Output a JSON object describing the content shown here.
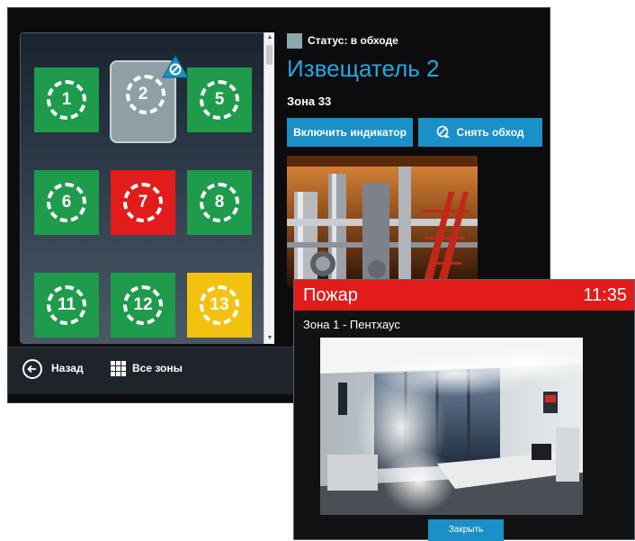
{
  "zones_panel": {
    "tiles": [
      {
        "number": "1",
        "state": "normal",
        "color": "#1e9b4b"
      },
      {
        "number": "2",
        "state": "bypassed",
        "color": "#8ea0a6"
      },
      {
        "number": "5",
        "state": "normal",
        "color": "#1e9b4b"
      },
      {
        "number": "6",
        "state": "normal",
        "color": "#1e9b4b"
      },
      {
        "number": "7",
        "state": "alarm",
        "color": "#e21b1b"
      },
      {
        "number": "8",
        "state": "normal",
        "color": "#1e9b4b"
      },
      {
        "number": "11",
        "state": "normal",
        "color": "#1e9b4b"
      },
      {
        "number": "12",
        "state": "normal",
        "color": "#1e9b4b"
      },
      {
        "number": "13",
        "state": "fault",
        "color": "#f3c211"
      }
    ],
    "bypass_icon": "no-entry-icon"
  },
  "detail": {
    "status_label": "Статус: в обходе",
    "status_color": "#8aa7ad",
    "title": "Извещатель 2",
    "zone": "Зона 33",
    "enable_indicator_button": "Включить индикатор",
    "remove_bypass_button": "Снять обход",
    "remove_bypass_icon": "bypass-off-icon"
  },
  "bottom_bar": {
    "back_label": "Назад",
    "back_icon": "arrow-left-circle-icon",
    "all_zones_label": "Все зоны",
    "all_zones_icon": "grid-icon"
  },
  "fire_dialog": {
    "title": "Пожар",
    "time": "11:35",
    "zone": "Зона 1 - Пентхаус",
    "close_button": "Закрыть",
    "header_color": "#e21b1b"
  }
}
